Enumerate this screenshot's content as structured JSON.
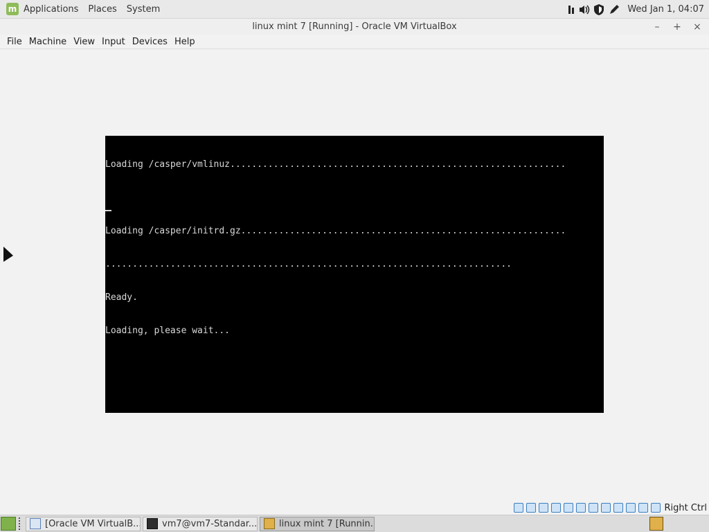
{
  "top_panel": {
    "menus": [
      "Applications",
      "Places",
      "System"
    ],
    "clock": "Wed Jan  1, 04:07",
    "tray_icons": [
      "network-icon",
      "volume-icon",
      "shield-icon",
      "pen-icon"
    ]
  },
  "window": {
    "title": "linux mint 7 [Running] - Oracle VM VirtualBox",
    "controls": [
      "–",
      "+",
      "×"
    ]
  },
  "menubar": [
    "File",
    "Machine",
    "View",
    "Input",
    "Devices",
    "Help"
  ],
  "console": {
    "lines": [
      "Loading /casper/vmlinuz..............................................................",
      "",
      "Loading /casper/initrd.gz............................................................",
      "...........................................................................",
      "Ready.",
      "Loading, please wait..."
    ]
  },
  "statusbar": {
    "icons": [
      "hard-disk-icon",
      "optical-drive-icon",
      "audio-icon",
      "network-icon",
      "usb-icon",
      "shared-folder-icon",
      "display-icon",
      "video-capture-icon",
      "cpu-icon",
      "guest-additions-icon",
      "mouse-integration-icon",
      "keyboard-icon"
    ],
    "host_key": "Right Ctrl"
  },
  "taskbar": {
    "tasks": [
      {
        "label": "[Oracle VM VirtualB...",
        "icon": "virtualbox-icon"
      },
      {
        "label": "vm7@vm7-Standar...",
        "icon": "terminal-icon"
      },
      {
        "label": "linux mint 7 [Runnin...",
        "icon": "vm-window-icon"
      }
    ]
  },
  "colors": {
    "console_bg": "#000000",
    "console_fg": "#d8d8d8",
    "panel_bg": "#e9e9e9",
    "mint_green": "#8fbc5a"
  }
}
